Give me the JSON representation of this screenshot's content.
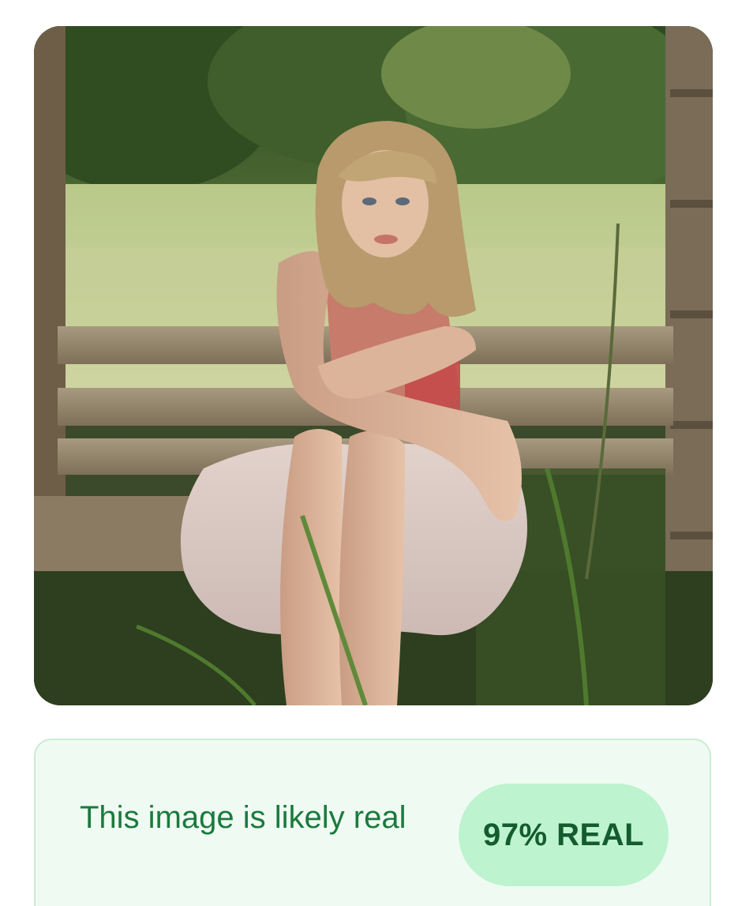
{
  "photo": {
    "icon": "analyzed-photo",
    "description_role": "analyzed-image"
  },
  "result": {
    "verdict_text": "This image is likely real",
    "score_label": "97% REAL",
    "score_percent": 97,
    "accent_color": "#1b7a3e",
    "card_bg": "#effbf2",
    "pill_bg": "#bdf3cf"
  }
}
